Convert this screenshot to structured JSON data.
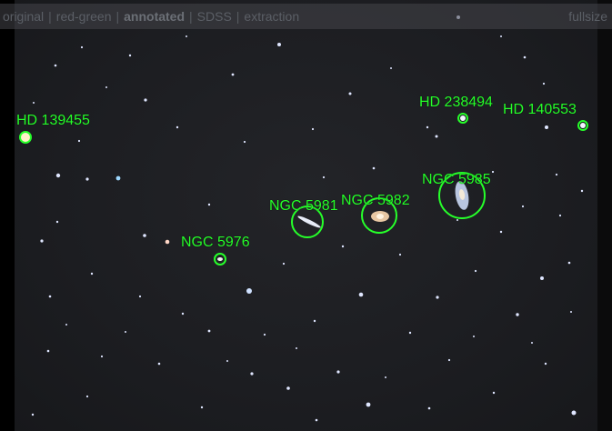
{
  "menu": {
    "items": [
      "original",
      "red-green",
      "annotated",
      "SDSS",
      "extraction"
    ],
    "active": "annotated",
    "fullsize": "fullsize"
  },
  "annotations": {
    "hd139455": "HD 139455",
    "hd238494": "HD 238494",
    "hd140553": "HD 140553",
    "ngc5985": "NGC 5985",
    "ngc5981": "NGC 5981",
    "ngc5982": "NGC 5982",
    "ngc5976": "NGC 5976"
  },
  "colors": {
    "annotation": "#26ff2a",
    "sky": "#1e1f23"
  }
}
